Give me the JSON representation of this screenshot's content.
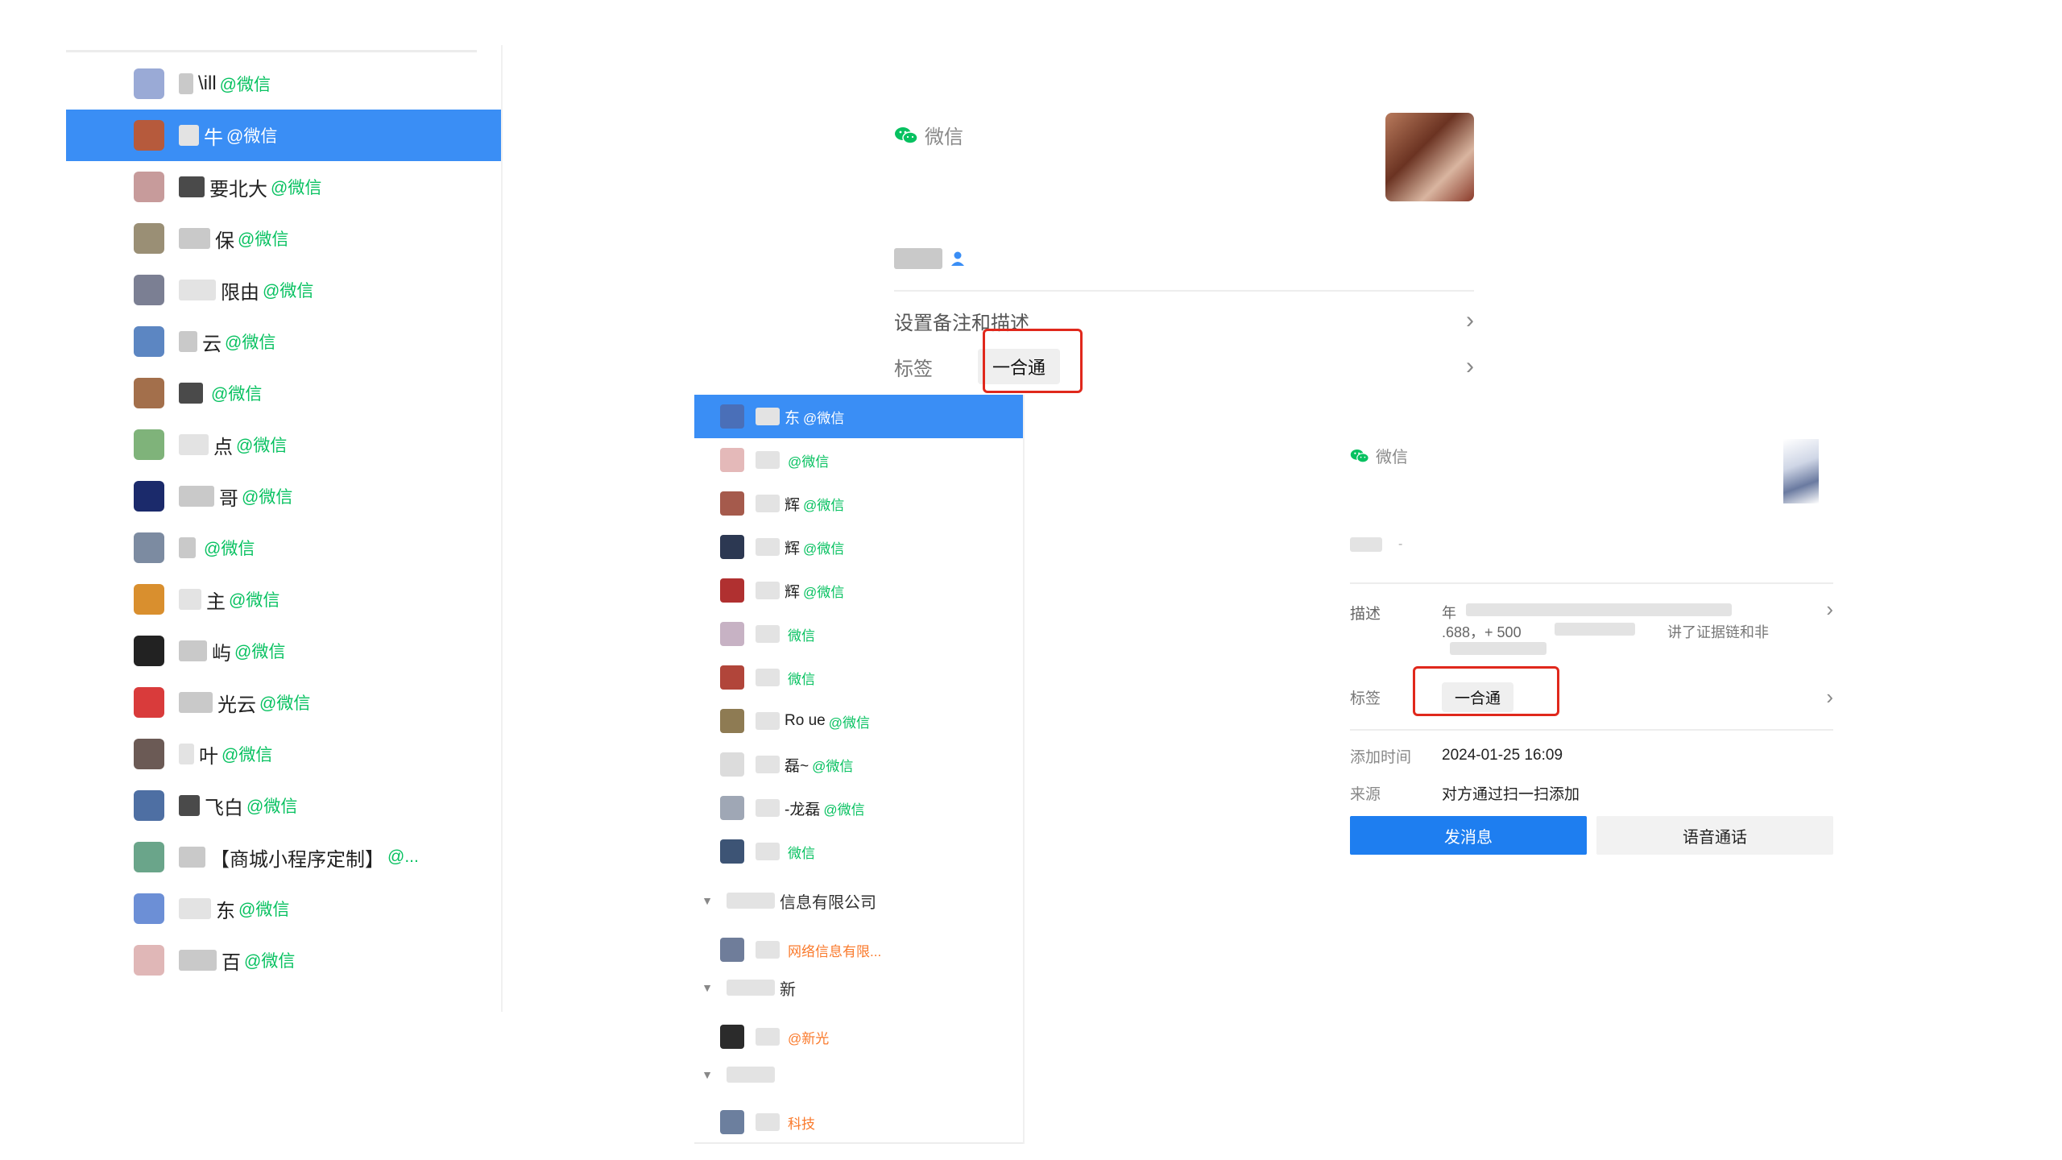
{
  "left_contacts": {
    "selected_index": 1,
    "items": [
      {
        "name": "\\ill",
        "suffix": "@微信",
        "avatar_color": "#9aaad6"
      },
      {
        "name": "牛",
        "suffix": "@微信",
        "avatar_color": "#b65a3c"
      },
      {
        "name": "要北大",
        "suffix": "@微信",
        "avatar_color": "#c79b9b"
      },
      {
        "name": "保",
        "suffix": "@微信",
        "avatar_color": "#9a8f75"
      },
      {
        "name": "限由",
        "suffix": "@微信",
        "avatar_color": "#7b7f93"
      },
      {
        "name": "云",
        "suffix": "@微信",
        "avatar_color": "#5c86c2"
      },
      {
        "name": "",
        "suffix": "@微信",
        "avatar_color": "#a36f4b"
      },
      {
        "name": "点",
        "suffix": "@微信",
        "avatar_color": "#7fb37a"
      },
      {
        "name": "哥",
        "suffix": "@微信",
        "avatar_color": "#1b2a6b"
      },
      {
        "name": "",
        "suffix": "@微信",
        "avatar_color": "#7c8ba1"
      },
      {
        "name": "主",
        "suffix": "@微信",
        "avatar_color": "#d98f2e"
      },
      {
        "name": "屿",
        "suffix": "@微信",
        "avatar_color": "#222222"
      },
      {
        "name": "光云",
        "suffix": "@微信",
        "avatar_color": "#d93b3b"
      },
      {
        "name": "叶",
        "suffix": "@微信",
        "avatar_color": "#6b5a55"
      },
      {
        "name": "飞白",
        "suffix": "@微信",
        "avatar_color": "#4e6fa3"
      },
      {
        "name": "【商城小程序定制】",
        "suffix": "@...",
        "avatar_color": "#6aa58a"
      },
      {
        "name": "东",
        "suffix": "@微信",
        "avatar_color": "#6c8fd6"
      },
      {
        "name": "百",
        "suffix": "@微信",
        "avatar_color": "#e0b7b7"
      }
    ]
  },
  "card1": {
    "brand": "微信",
    "remark_row": "设置备注和描述",
    "tag_label": "标签",
    "tag_value": "一合通",
    "colors": {
      "highlight": "#e0281c",
      "wechat": "#07c160"
    }
  },
  "mid_contacts": {
    "items": [
      {
        "name": "东",
        "suffix": "@微信",
        "avatar_color": "#4a6fb8",
        "selected": true
      },
      {
        "name": "",
        "suffix": "@微信",
        "avatar_color": "#e4b9b9"
      },
      {
        "name": "辉",
        "suffix": "@微信",
        "avatar_color": "#a55a4c"
      },
      {
        "name": "辉",
        "suffix": "@微信",
        "avatar_color": "#2c3852"
      },
      {
        "name": "辉",
        "suffix": "@微信",
        "avatar_color": "#b03030"
      },
      {
        "name": "",
        "suffix": "微信",
        "avatar_color": "#c7b2c4"
      },
      {
        "name": "",
        "suffix": "微信",
        "avatar_color": "#b1453a"
      },
      {
        "name": "Ro ue",
        "suffix": "@微信",
        "avatar_color": "#8e7b53"
      },
      {
        "name": "磊~",
        "suffix": "@微信",
        "avatar_color": "#dcdcdc"
      },
      {
        "name": "-龙磊",
        "suffix": "@微信",
        "avatar_color": "#9fa7b5"
      },
      {
        "name": "",
        "suffix": "微信",
        "avatar_color": "#3d5475"
      }
    ],
    "group1": {
      "label": "信息有限公司"
    },
    "group1_item": {
      "name": "",
      "suffix": "网络信息有限...",
      "avatar_color": "#6f7d9a"
    },
    "group2": {
      "label": "新"
    },
    "group2_item": {
      "name": "",
      "suffix": "@新光",
      "avatar_color": "#2b2b2b"
    },
    "group3": {
      "label": ""
    },
    "group3_item": {
      "name": "",
      "suffix": "科技",
      "avatar_color": "#6c7f9e"
    }
  },
  "card2": {
    "brand": "微信",
    "desc_label": "描述",
    "desc_line1": "年",
    "desc_line2": ".688，+ 500",
    "desc_line3": "讲了证据链和非",
    "tag_label": "标签",
    "tag_value": "一合通",
    "added_label": "添加时间",
    "added_value": "2024-01-25 16:09",
    "source_label": "来源",
    "source_value": "对方通过扫一扫添加",
    "btn_message": "发消息",
    "btn_voice": "语音通话",
    "colors": {
      "primary_button": "#1e7ef0"
    }
  }
}
